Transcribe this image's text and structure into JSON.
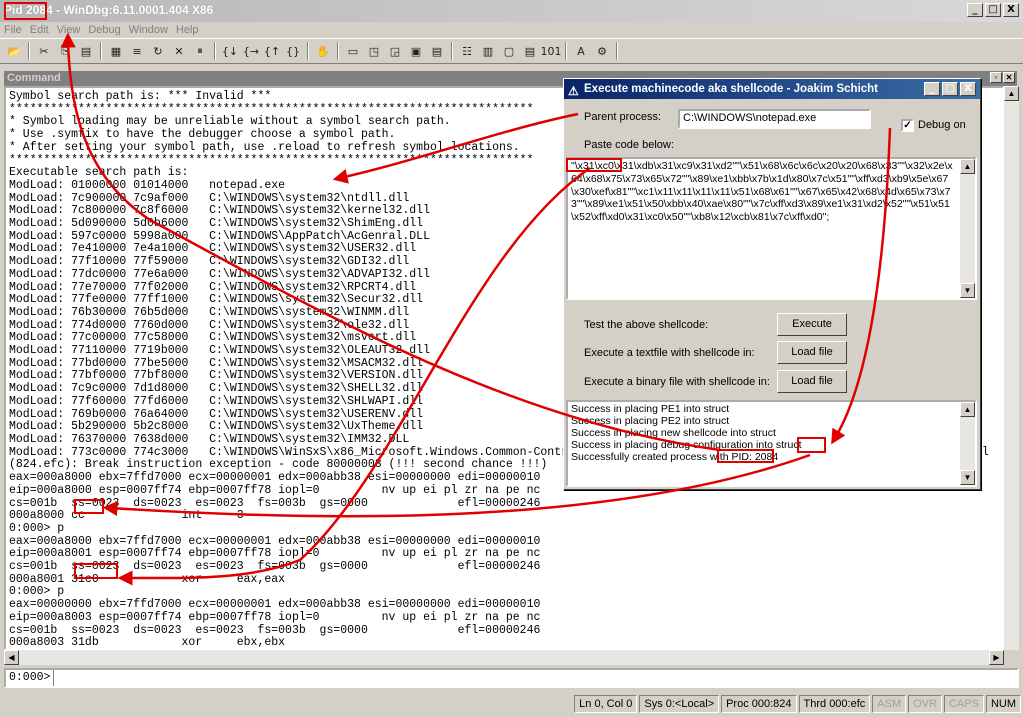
{
  "window": {
    "title": "Pid 2084 - WinDbg:6.11.0001.404 X86",
    "controls": {
      "minimize": "_",
      "maximize": "□",
      "close": "X"
    }
  },
  "menu": [
    "File",
    "Edit",
    "View",
    "Debug",
    "Window",
    "Help"
  ],
  "toolbar_icons": [
    "open-icon",
    "cut-icon",
    "copy-icon",
    "paste-icon",
    "source-icon",
    "go-icon",
    "restart-icon",
    "stop-icon",
    "break-icon",
    "step-into-icon",
    "step-over-icon",
    "step-out-icon",
    "run-to-cursor-icon",
    "hand-icon",
    "command-icon",
    "watch-icon",
    "locals-icon",
    "registers-icon",
    "memory-icon",
    "call-stack-icon",
    "disassembly-icon",
    "scratch-icon",
    "source-mode-icon",
    "hex-mode-icon",
    "font-icon",
    "options-icon"
  ],
  "command_window": {
    "title": "Command",
    "lines": [
      "Symbol search path is: *** Invalid ***",
      "****************************************************************************",
      "* Symbol loading may be unreliable without a symbol search path.",
      "* Use .symfix to have the debugger choose a symbol path.",
      "* After setting your symbol path, use .reload to refresh symbol locations.",
      "****************************************************************************",
      "Executable search path is:",
      "ModLoad: 01000000 01014000   notepad.exe",
      "ModLoad: 7c900000 7c9af000   C:\\WINDOWS\\system32\\ntdll.dll",
      "ModLoad: 7c800000 7c8f6000   C:\\WINDOWS\\system32\\kernel32.dll",
      "ModLoad: 5d090000 5d0b6000   C:\\WINDOWS\\system32\\ShimEng.dll",
      "ModLoad: 597c0000 5998a000   C:\\WINDOWS\\AppPatch\\AcGenral.DLL",
      "ModLoad: 7e410000 7e4a1000   C:\\WINDOWS\\system32\\USER32.dll",
      "ModLoad: 77f10000 77f59000   C:\\WINDOWS\\system32\\GDI32.dll",
      "ModLoad: 77dc0000 77e6a000   C:\\WINDOWS\\system32\\ADVAPI32.dll",
      "ModLoad: 77e70000 77f02000   C:\\WINDOWS\\system32\\RPCRT4.dll",
      "ModLoad: 77fe0000 77ff1000   C:\\WINDOWS\\system32\\Secur32.dll",
      "ModLoad: 76b30000 76b5d000   C:\\WINDOWS\\system32\\WINMM.dll",
      "ModLoad: 774d0000 7760d000   C:\\WINDOWS\\system32\\ole32.dll",
      "ModLoad: 77c00000 77c58000   C:\\WINDOWS\\system32\\msvcrt.dll",
      "ModLoad: 77110000 7719b000   C:\\WINDOWS\\system32\\OLEAUT32.dll",
      "ModLoad: 77bd0000 77be5000   C:\\WINDOWS\\system32\\MSACM32.dll",
      "ModLoad: 77bf0000 77bf8000   C:\\WINDOWS\\system32\\VERSION.dll",
      "ModLoad: 7c9c0000 7d1d8000   C:\\WINDOWS\\system32\\SHELL32.dll",
      "ModLoad: 77f60000 77fd6000   C:\\WINDOWS\\system32\\SHLWAPI.dll",
      "ModLoad: 769b0000 76a64000   C:\\WINDOWS\\system32\\USERENV.dll",
      "ModLoad: 5b290000 5b2c8000   C:\\WINDOWS\\system32\\UxTheme.dll",
      "ModLoad: 76370000 7638d000   C:\\WINDOWS\\system32\\IMM32.DLL",
      "ModLoad: 773c0000 774c3000   C:\\WINDOWS\\WinSxS\\x86_Microsoft.Windows.Common-Controls_6595b64144ccf1df_6.0.2600.2180_x-ww_a84f1ff9\\comctl32.dll",
      "(824.efc): Break instruction exception - code 80000003 (!!! second chance !!!)",
      "eax=000a8000 ebx=7ffd7000 ecx=00000001 edx=000abb38 esi=00000000 edi=00000010",
      "eip=000a8000 esp=0007ff74 ebp=0007ff78 iopl=0         nv up ei pl zr na pe nc",
      "cs=001b  ss=0023  ds=0023  es=0023  fs=003b  gs=0000             efl=00000246",
      "000a8000 cc              int     3",
      "0:000> p",
      "eax=000a8000 ebx=7ffd7000 ecx=00000001 edx=000abb38 esi=00000000 edi=00000010",
      "eip=000a8001 esp=0007ff74 ebp=0007ff78 iopl=0         nv up ei pl zr na pe nc",
      "cs=001b  ss=0023  ds=0023  es=0023  fs=003b  gs=0000             efl=00000246",
      "000a8001 31c0            xor     eax,eax",
      "0:000> p",
      "eax=00000000 ebx=7ffd7000 ecx=00000001 edx=000abb38 esi=00000000 edi=00000010",
      "eip=000a8003 esp=0007ff74 ebp=0007ff78 iopl=0         nv up ei pl zr na pe nc",
      "cs=001b  ss=0023  ds=0023  es=0023  fs=003b  gs=0000             efl=00000246",
      "000a8003 31db            xor     ebx,ebx"
    ],
    "prompt": "0:000>",
    "input_value": ""
  },
  "status_bar": [
    {
      "label": "Ln 0, Col 0",
      "dim": false
    },
    {
      "label": "Sys 0:<Local>",
      "dim": false
    },
    {
      "label": "Proc 000:824",
      "dim": false
    },
    {
      "label": "Thrd 000:efc",
      "dim": false
    },
    {
      "label": "ASM",
      "dim": true
    },
    {
      "label": "OVR",
      "dim": true
    },
    {
      "label": "CAPS",
      "dim": true
    },
    {
      "label": "NUM",
      "dim": false
    }
  ],
  "dialog": {
    "title": "Execute machinecode aka shellcode - Joakim Schicht",
    "parent_process_label": "Parent process:",
    "parent_process_value": "C:\\WINDOWS\\notepad.exe",
    "debug_label": "Debug on",
    "debug_checked": true,
    "paste_label": "Paste code below:",
    "code": "\"\\x31\\xc0\\x31\\xdb\\x31\\xc9\\x31\\xd2\"\"\\x51\\x68\\x6c\\x6c\\x20\\x20\\x68\\x33\"\"\\x32\\x2e\\x64\\x68\\x75\\x73\\x65\\x72\"\"\\x89\\xe1\\xbb\\x7b\\x1d\\x80\\x7c\\x51\"\"\\xff\\xd3\\xb9\\x5e\\x67\\x30\\xef\\x81\"\"\\xc1\\x11\\x11\\x11\\x11\\x51\\x68\\x61\"\"\\x67\\x65\\x42\\x68\\x4d\\x65\\x73\\x73\"\"\\x89\\xe1\\x51\\x50\\xbb\\x40\\xae\\x80\"\"\\x7c\\xff\\xd3\\x89\\xe1\\x31\\xd2\\x52\"\"\\x51\\x51\\x52\\xff\\xd0\\x31\\xc0\\x50\"\"\\xb8\\x12\\xcb\\x81\\x7c\\xff\\xd0\";",
    "test_label": "Test the above shellcode:",
    "execute_btn": "Execute",
    "textfile_label": "Execute a textfile with shellcode in:",
    "textfile_btn": "Load file",
    "binary_label": "Execute a binary file with shellcode in:",
    "binary_btn": "Load file",
    "log": [
      "Success in placing PE1 into struct",
      "Success in placing PE2 into struct",
      "Success in placing new shellcode into struct",
      "Success in placing debug configuration into struct",
      "Successfully created process with PID: 2084"
    ]
  },
  "colors": {
    "annotation": "#e00000",
    "dialog_title": "#0a246a",
    "face": "#d4d0c8"
  }
}
